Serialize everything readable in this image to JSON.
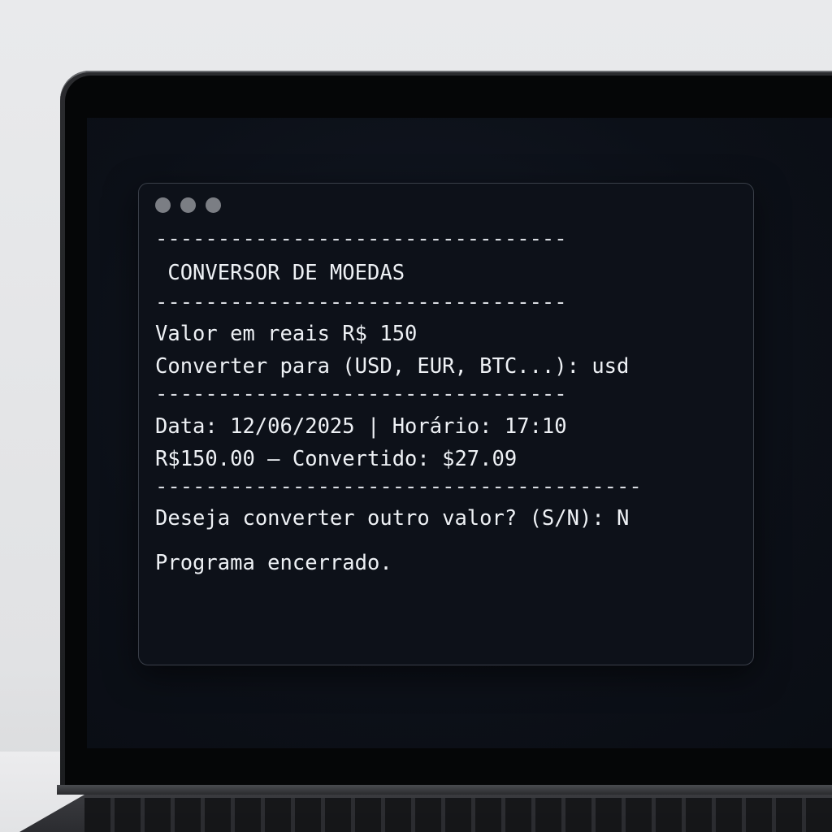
{
  "terminal": {
    "lines": {
      "sep1": "---------------------------------",
      "title": " CONVERSOR DE MOEDAS",
      "sep2": "---------------------------------",
      "valor": "Valor em reais R$ 150",
      "converter": "Converter para (USD, EUR, BTC...): usd",
      "sep3": "---------------------------------",
      "data": "Data: 12/06/2025 | Horário: 17:10",
      "resultado": "R$150.00 – Convertido: $27.09",
      "sep4": "---------------------------------------",
      "pergunta": "Deseja converter outro valor? (S/N): N",
      "fim": "Programa encerrado."
    }
  },
  "colors": {
    "terminal_bg": "#0d1119",
    "terminal_text": "#eef1f5",
    "window_dot": "#7b7e84"
  }
}
